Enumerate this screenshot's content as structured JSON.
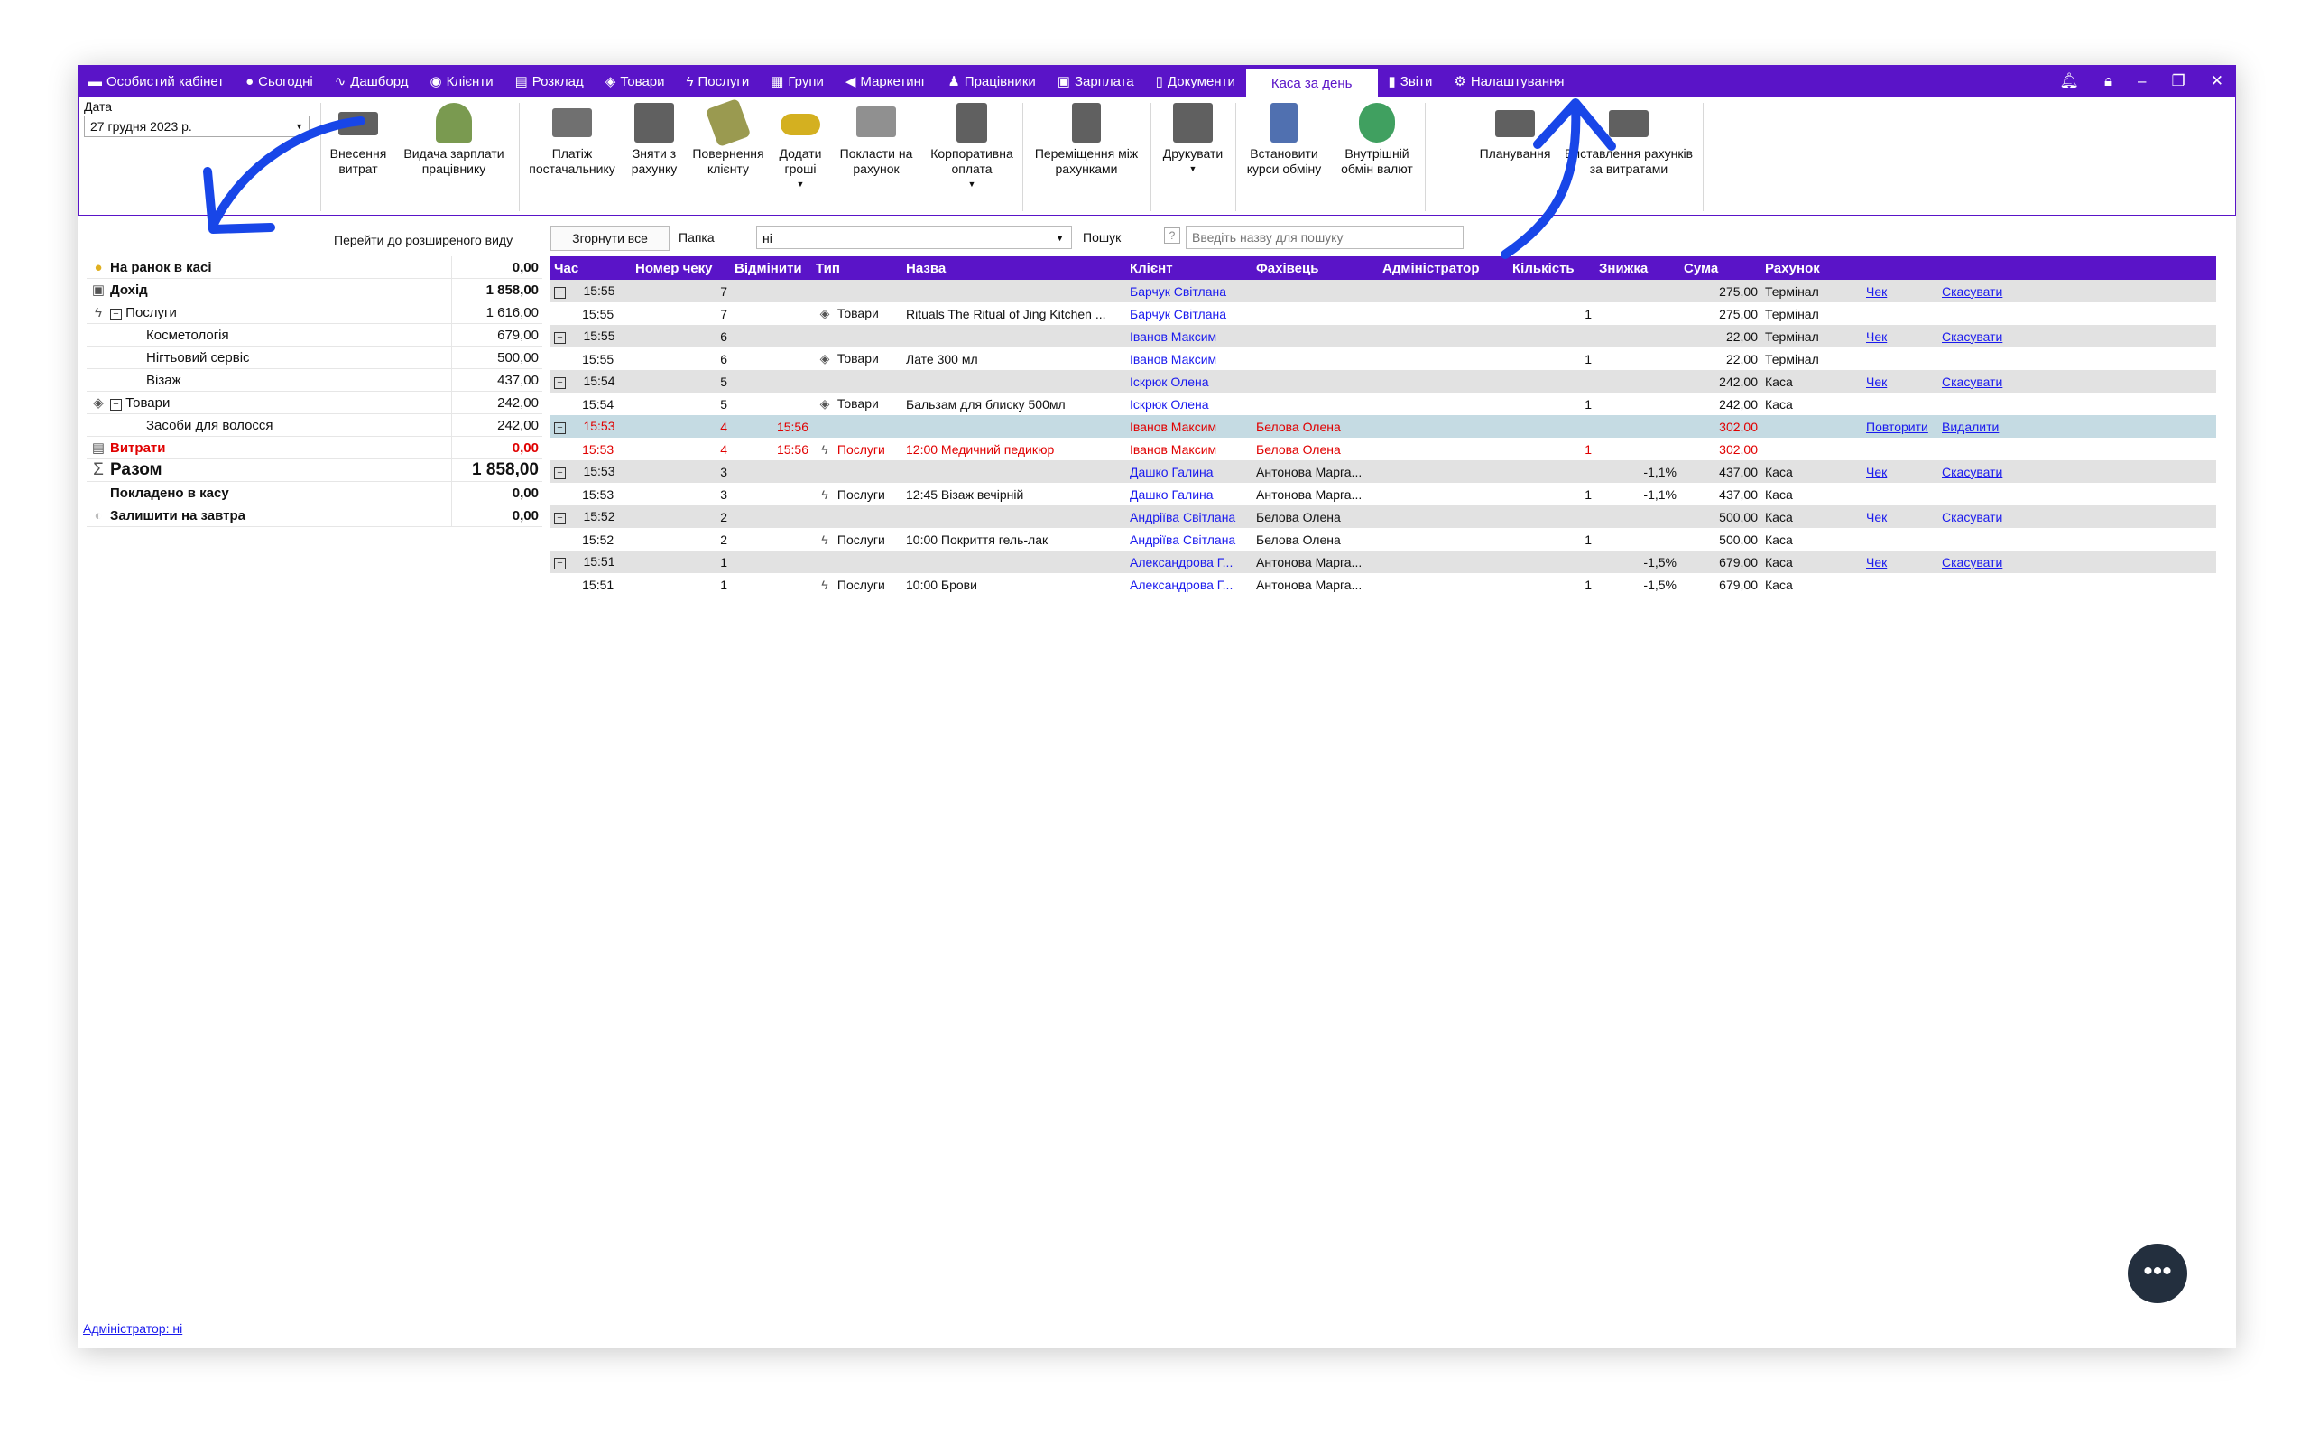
{
  "nav": {
    "items": [
      {
        "label": "Особистий кабінет",
        "icon": "wallet-icon"
      },
      {
        "label": "Сьогодні",
        "icon": "clock-icon"
      },
      {
        "label": "Дашборд",
        "icon": "pulse-icon"
      },
      {
        "label": "Клієнти",
        "icon": "user-circle-icon"
      },
      {
        "label": "Розклад",
        "icon": "calendar-icon"
      },
      {
        "label": "Товари",
        "icon": "box-icon"
      },
      {
        "label": "Послуги",
        "icon": "bolt-icon"
      },
      {
        "label": "Групи",
        "icon": "group-icon"
      },
      {
        "label": "Маркетинг",
        "icon": "megaphone-icon"
      },
      {
        "label": "Працівники",
        "icon": "person-icon"
      },
      {
        "label": "Зарплата",
        "icon": "money-icon"
      },
      {
        "label": "Документи",
        "icon": "document-icon"
      },
      {
        "label": "Каса за день",
        "icon": ""
      },
      {
        "label": "Звіти",
        "icon": "bar-chart-icon"
      },
      {
        "label": "Налаштування",
        "icon": "gear-icon"
      }
    ],
    "active_index": 12
  },
  "ribbon": {
    "date_label": "Дата",
    "date_value": "27 грудня  2023 р.",
    "buttons": [
      {
        "l1": "Внесення",
        "l2": "витрат",
        "color": "#606060"
      },
      {
        "l1": "Видача зарплати",
        "l2": "працівнику",
        "color": "#7a9a50"
      },
      {
        "l1": "Платіж",
        "l2": "постачальнику",
        "color": "#707070"
      },
      {
        "l1": "Зняти з",
        "l2": "рахунку",
        "color": "#606060"
      },
      {
        "l1": "Повернення",
        "l2": "клієнту",
        "color": "#9a9a50"
      },
      {
        "l1": "Додати",
        "l2": "гроші",
        "color": "#d4b020"
      },
      {
        "l1": "Покласти на",
        "l2": "рахунок",
        "color": "#909090"
      },
      {
        "l1": "Корпоративна",
        "l2": "оплата",
        "color": "#606060"
      },
      {
        "l1": "Переміщення між",
        "l2": "рахунками",
        "color": "#606060"
      },
      {
        "l1": "Друкувати",
        "l2": "",
        "color": "#606060"
      },
      {
        "l1": "Встановити",
        "l2": "курси обміну",
        "color": "#5070b0"
      },
      {
        "l1": "Внутрішній",
        "l2": "обмін валют",
        "color": "#40a060"
      },
      {
        "l1": "Планування",
        "l2": "",
        "color": "#606060"
      },
      {
        "l1": "Виставлення рахунків",
        "l2": "за витратами",
        "color": "#606060"
      }
    ]
  },
  "summary": {
    "goto_extended": "Перейти до розширеного виду",
    "rows": [
      {
        "label": "На ранок в касі",
        "value": "0,00"
      },
      {
        "label": "Дохід",
        "value": "1 858,00"
      },
      {
        "label": "Послуги",
        "value": "1 616,00"
      },
      {
        "label": "Косметологія",
        "value": "679,00"
      },
      {
        "label": "Нігтьовий сервіс",
        "value": "500,00"
      },
      {
        "label": "Візаж",
        "value": "437,00"
      },
      {
        "label": "Товари",
        "value": "242,00"
      },
      {
        "label": "Засоби для волосся",
        "value": "242,00"
      },
      {
        "label": "Витрати",
        "value": "0,00"
      },
      {
        "label": "Разом",
        "value": "1 858,00"
      },
      {
        "label": "Покладено в касу",
        "value": "0,00"
      },
      {
        "label": "Залишити на завтра",
        "value": "0,00"
      }
    ]
  },
  "toolbar": {
    "collapse_all": "Згорнути все",
    "folder_label": "Папка",
    "folder_value": "ні",
    "search_label": "Пошук",
    "search_help": "?",
    "search_placeholder": "Введіть назву для пошуку"
  },
  "table": {
    "headers": [
      "Час",
      "Номер чеку",
      "Відмінити",
      "Тип",
      "Назва",
      "Клієнт",
      "Фахівець",
      "Адміністратор",
      "Кількість",
      "Знижка",
      "Сума",
      "Рахунок"
    ],
    "rows": [
      {
        "time": "15:55",
        "num": "7",
        "cancel": "",
        "type": "",
        "name": "",
        "client": "Барчук Світлана",
        "spec": "",
        "qty": "",
        "disc": "",
        "sum": "275,00",
        "acc": "Термінал",
        "a1": "Чек",
        "a2": "Скасувати"
      },
      {
        "time": "15:55",
        "num": "7",
        "cancel": "",
        "type": "Товари",
        "name": "Rituals The Ritual of Jing Kitchen ...",
        "client": "Барчук Світлана",
        "spec": "",
        "qty": "1",
        "disc": "",
        "sum": "275,00",
        "acc": "Термінал",
        "a1": "",
        "a2": ""
      },
      {
        "time": "15:55",
        "num": "6",
        "cancel": "",
        "type": "",
        "name": "",
        "client": "Іванов Максим",
        "spec": "",
        "qty": "",
        "disc": "",
        "sum": "22,00",
        "acc": "Термінал",
        "a1": "Чек",
        "a2": "Скасувати"
      },
      {
        "time": "15:55",
        "num": "6",
        "cancel": "",
        "type": "Товари",
        "name": "Лате 300 мл",
        "client": "Іванов Максим",
        "spec": "",
        "qty": "1",
        "disc": "",
        "sum": "22,00",
        "acc": "Термінал",
        "a1": "",
        "a2": ""
      },
      {
        "time": "15:54",
        "num": "5",
        "cancel": "",
        "type": "",
        "name": "",
        "client": "Іскрюк Олена",
        "spec": "",
        "qty": "",
        "disc": "",
        "sum": "242,00",
        "acc": "Каса",
        "a1": "Чек",
        "a2": "Скасувати"
      },
      {
        "time": "15:54",
        "num": "5",
        "cancel": "",
        "type": "Товари",
        "name": "Бальзам для блиску 500мл",
        "client": "Іскрюк Олена",
        "spec": "",
        "qty": "1",
        "disc": "",
        "sum": "242,00",
        "acc": "Каса",
        "a1": "",
        "a2": ""
      },
      {
        "time": "15:53",
        "num": "4",
        "cancel": "15:56",
        "type": "",
        "name": "",
        "client": "Іванов Максим",
        "spec": "Белова Олена",
        "qty": "",
        "disc": "",
        "sum": "302,00",
        "acc": "",
        "a1": "Повторити",
        "a2": "Видалити"
      },
      {
        "time": "15:53",
        "num": "4",
        "cancel": "15:56",
        "type": "Послуги",
        "name": "12:00 Медичний педикюр",
        "client": "Іванов Максим",
        "spec": "Белова Олена",
        "qty": "1",
        "disc": "",
        "sum": "302,00",
        "acc": "",
        "a1": "",
        "a2": ""
      },
      {
        "time": "15:53",
        "num": "3",
        "cancel": "",
        "type": "",
        "name": "",
        "client": "Дашко Галина",
        "spec": "Антонова Марга...",
        "qty": "",
        "disc": "-1,1%",
        "sum": "437,00",
        "acc": "Каса",
        "a1": "Чек",
        "a2": "Скасувати"
      },
      {
        "time": "15:53",
        "num": "3",
        "cancel": "",
        "type": "Послуги",
        "name": "12:45 Візаж вечірній",
        "client": "Дашко Галина",
        "spec": "Антонова Марга...",
        "qty": "1",
        "disc": "-1,1%",
        "sum": "437,00",
        "acc": "Каса",
        "a1": "",
        "a2": ""
      },
      {
        "time": "15:52",
        "num": "2",
        "cancel": "",
        "type": "",
        "name": "",
        "client": "Андріїва Світлана",
        "spec": "Белова Олена",
        "qty": "",
        "disc": "",
        "sum": "500,00",
        "acc": "Каса",
        "a1": "Чек",
        "a2": "Скасувати"
      },
      {
        "time": "15:52",
        "num": "2",
        "cancel": "",
        "type": "Послуги",
        "name": "10:00 Покриття гель-лак",
        "client": "Андріїва Світлана",
        "spec": "Белова Олена",
        "qty": "1",
        "disc": "",
        "sum": "500,00",
        "acc": "Каса",
        "a1": "",
        "a2": ""
      },
      {
        "time": "15:51",
        "num": "1",
        "cancel": "",
        "type": "",
        "name": "",
        "client": "Александрова Г...",
        "spec": "Антонова Марга...",
        "qty": "",
        "disc": "-1,5%",
        "sum": "679,00",
        "acc": "Каса",
        "a1": "Чек",
        "a2": "Скасувати"
      },
      {
        "time": "15:51",
        "num": "1",
        "cancel": "",
        "type": "Послуги",
        "name": "10:00 Брови",
        "client": "Александрова Г...",
        "spec": "Антонова Марга...",
        "qty": "1",
        "disc": "-1,5%",
        "sum": "679,00",
        "acc": "Каса",
        "a1": "",
        "a2": ""
      }
    ]
  },
  "footer": {
    "admin_link": "Адміністратор: ні"
  },
  "colors": {
    "accent": "#5a14c8",
    "annotation_arrow": "#1846e8",
    "cancelled": "#e00000",
    "link": "#1a1aee"
  }
}
